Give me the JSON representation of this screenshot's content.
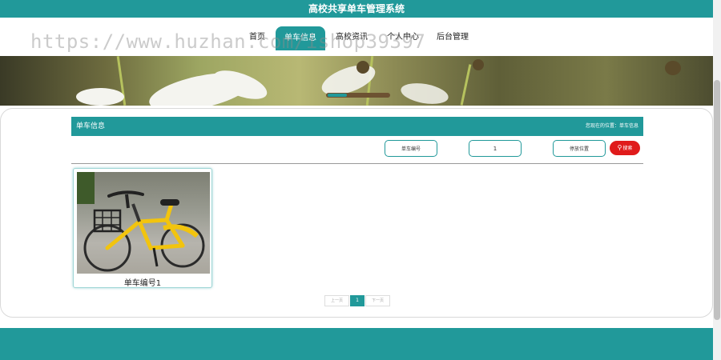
{
  "header": {
    "title": "高校共享单车管理系统"
  },
  "nav": {
    "items": [
      {
        "label": "首页",
        "active": false
      },
      {
        "label": "单车信息",
        "active": true
      },
      {
        "label": "高校资讯",
        "active": false
      },
      {
        "label": "个人中心",
        "active": false
      },
      {
        "label": "后台管理",
        "active": false
      }
    ]
  },
  "watermark": {
    "text": "https://www.huzhan.com/ishop39397"
  },
  "section": {
    "title": "单车信息",
    "location": "您现在的位置：单车信息"
  },
  "search": {
    "fields": [
      {
        "value": "单车编号"
      },
      {
        "value": "1"
      },
      {
        "value": "停放位置"
      }
    ],
    "button_label": "搜索"
  },
  "bikes": [
    {
      "name": "单车编号1"
    }
  ],
  "pagination": {
    "prev_label": "上一页",
    "current_page": "1",
    "next_label": "下一页"
  },
  "colors": {
    "primary": "#21999a",
    "search_button": "#e01b1b"
  }
}
